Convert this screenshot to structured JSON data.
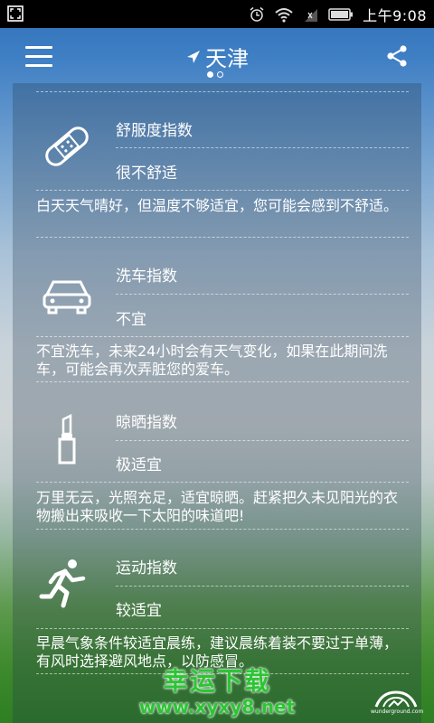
{
  "status_bar": {
    "time": "上午9:08",
    "icons": [
      "screenshot-icon",
      "alarm-icon",
      "wifi-icon",
      "signal-icon",
      "battery-icon"
    ]
  },
  "header": {
    "city": "天津",
    "page_count": 2,
    "active_page": 0,
    "icons": [
      "menu-icon",
      "location-arrow-icon",
      "share-icon"
    ]
  },
  "indices": [
    {
      "icon": "bandage-icon",
      "title": "舒服度指数",
      "level": "很不舒适",
      "desc": "白天天气晴好，但温度不够适宜，您可能会感到不舒适。"
    },
    {
      "icon": "car-icon",
      "title": "洗车指数",
      "level": "不宜",
      "desc": "不宜洗车，未来24小时会有天气变化，如果在此期间洗车，可能会再次弄脏您的爱车。"
    },
    {
      "icon": "lipstick-icon",
      "title": "晾晒指数",
      "level": "极适宜",
      "desc": "万里无云，光照充足，适宜晾晒。赶紧把久未见阳光的衣物搬出来吸收一下太阳的味道吧!"
    },
    {
      "icon": "running-person-icon",
      "title": "运动指数",
      "level": "较适宜",
      "desc": "早晨气象条件较适宜晨练，建议晨练着装不要过于单薄，有风时选择避风地点，以防感冒。"
    }
  ],
  "watermark": {
    "main": "幸运下载",
    "sub": "www.xyxy8.net",
    "color": "#2cc534"
  },
  "footer_logo": {
    "icon": "wunderground-logo",
    "text": "wunderground.com"
  }
}
